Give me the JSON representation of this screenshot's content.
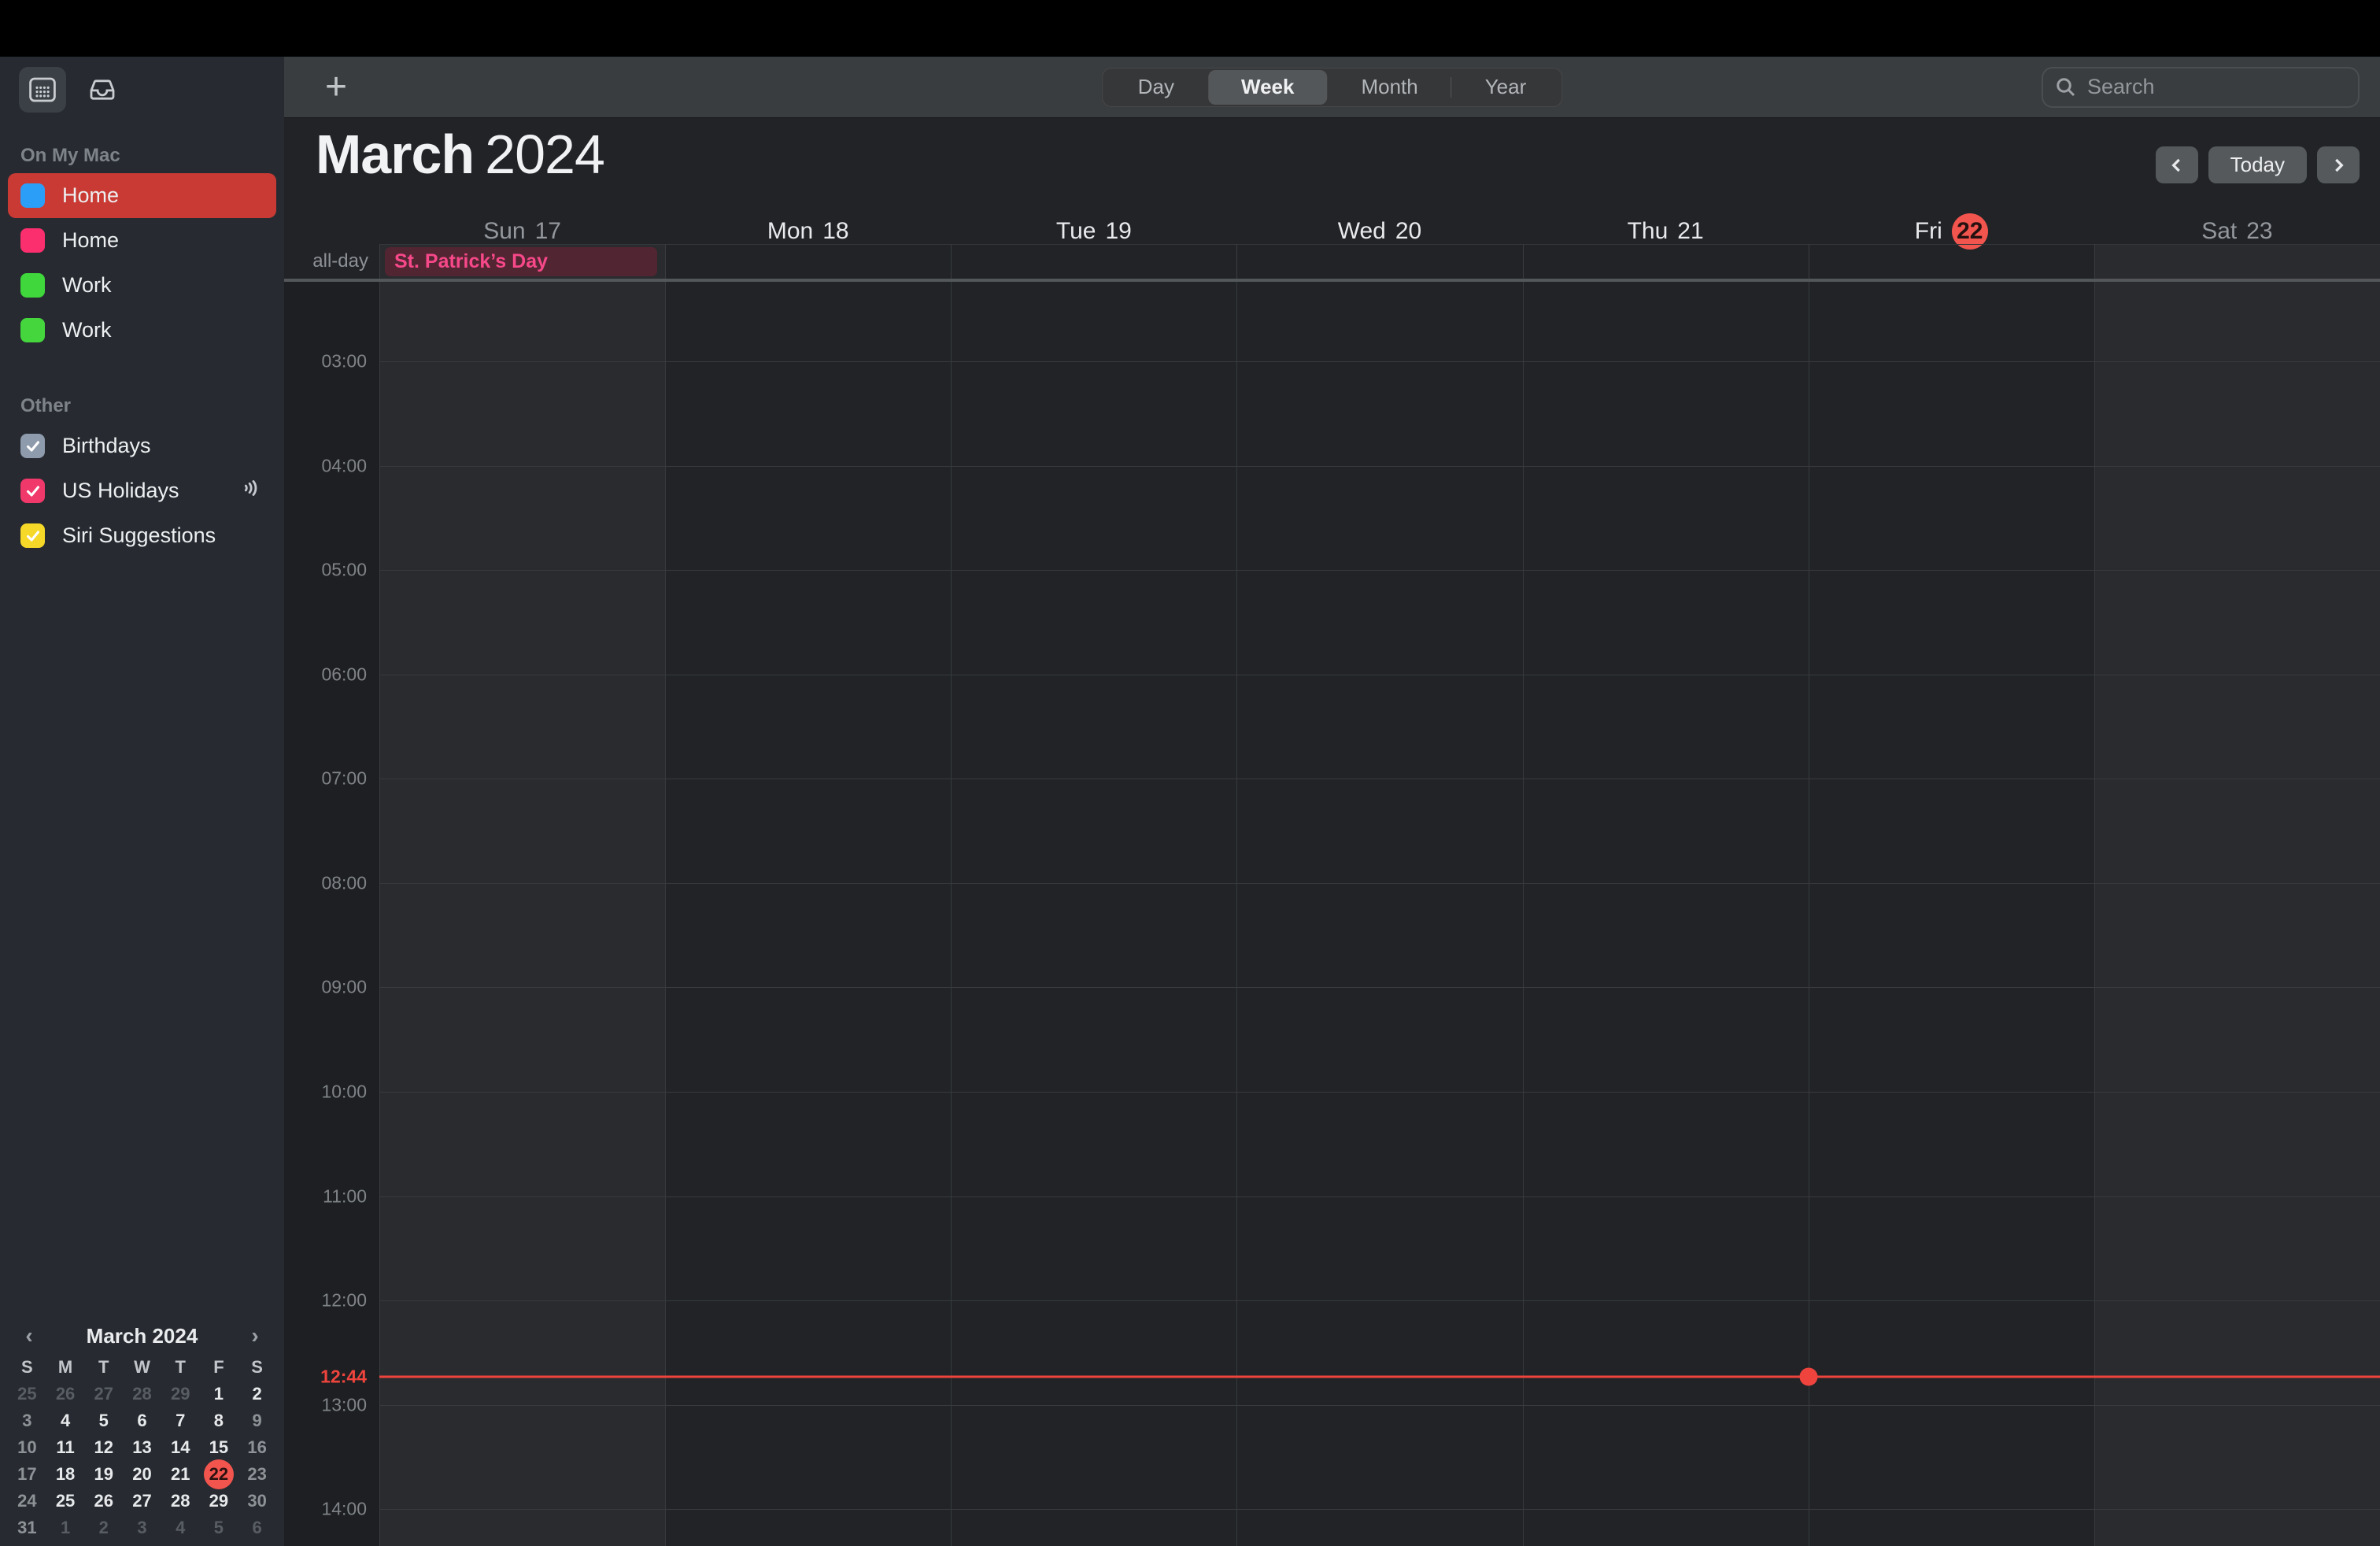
{
  "toolbar": {
    "add_label": "+",
    "tabs": [
      {
        "label": "Day",
        "active": false
      },
      {
        "label": "Week",
        "active": true
      },
      {
        "label": "Month",
        "active": false
      },
      {
        "label": "Year",
        "active": false
      }
    ],
    "search_placeholder": "Search"
  },
  "sidebar": {
    "toolbar_icons": [
      "calendar",
      "inbox"
    ],
    "sections": [
      {
        "title": "On My Mac",
        "items": [
          {
            "label": "Home",
            "color": "#2b9ef7",
            "selected": true
          },
          {
            "label": "Home",
            "color": "#fb2e6e",
            "selected": false
          },
          {
            "label": "Work",
            "color": "#3fd73c",
            "selected": false
          },
          {
            "label": "Work",
            "color": "#45d63e",
            "selected": false
          }
        ]
      },
      {
        "title": "Other",
        "items": [
          {
            "label": "Birthdays",
            "color": "#8e9bac",
            "checked": true
          },
          {
            "label": "US Holidays",
            "color": "#f0386b",
            "checked": true,
            "broadcast": true
          },
          {
            "label": "Siri Suggestions",
            "color": "#f6d928",
            "checked": true
          }
        ]
      }
    ],
    "mini_calendar": {
      "title": "March 2024",
      "dow": [
        "S",
        "M",
        "T",
        "W",
        "T",
        "F",
        "S"
      ],
      "weeks": [
        [
          {
            "d": "25",
            "m": 1
          },
          {
            "d": "26",
            "m": 1
          },
          {
            "d": "27",
            "m": 1
          },
          {
            "d": "28",
            "m": 1
          },
          {
            "d": "29",
            "m": 1
          },
          {
            "d": "1"
          },
          {
            "d": "2"
          }
        ],
        [
          {
            "d": "3",
            "w": 1
          },
          {
            "d": "4"
          },
          {
            "d": "5"
          },
          {
            "d": "6"
          },
          {
            "d": "7"
          },
          {
            "d": "8"
          },
          {
            "d": "9",
            "w": 1
          }
        ],
        [
          {
            "d": "10",
            "w": 1
          },
          {
            "d": "11"
          },
          {
            "d": "12"
          },
          {
            "d": "13"
          },
          {
            "d": "14"
          },
          {
            "d": "15"
          },
          {
            "d": "16",
            "w": 1
          }
        ],
        [
          {
            "d": "17",
            "w": 1
          },
          {
            "d": "18"
          },
          {
            "d": "19"
          },
          {
            "d": "20"
          },
          {
            "d": "21"
          },
          {
            "d": "22",
            "t": 1
          },
          {
            "d": "23",
            "w": 1
          }
        ],
        [
          {
            "d": "24",
            "w": 1
          },
          {
            "d": "25"
          },
          {
            "d": "26"
          },
          {
            "d": "27"
          },
          {
            "d": "28"
          },
          {
            "d": "29"
          },
          {
            "d": "30",
            "w": 1
          }
        ],
        [
          {
            "d": "31",
            "w": 1
          },
          {
            "d": "1",
            "m": 1
          },
          {
            "d": "2",
            "m": 1
          },
          {
            "d": "3",
            "m": 1
          },
          {
            "d": "4",
            "m": 1
          },
          {
            "d": "5",
            "m": 1
          },
          {
            "d": "6",
            "m": 1
          }
        ]
      ]
    }
  },
  "header": {
    "month": "March",
    "year": "2024",
    "today_label": "Today"
  },
  "week": {
    "days": [
      {
        "name": "Sun",
        "num": "17",
        "weekend": true
      },
      {
        "name": "Mon",
        "num": "18"
      },
      {
        "name": "Tue",
        "num": "19"
      },
      {
        "name": "Wed",
        "num": "20"
      },
      {
        "name": "Thu",
        "num": "21"
      },
      {
        "name": "Fri",
        "num": "22",
        "today": true
      },
      {
        "name": "Sat",
        "num": "23",
        "weekend": true
      }
    ],
    "allday_label": "all-day",
    "allday_events": [
      {
        "title": "St. Patrick’s Day",
        "day_index": 0,
        "bg": "#512531",
        "fg": "#f7488a"
      }
    ],
    "hours": [
      "03:00",
      "04:00",
      "05:00",
      "06:00",
      "07:00",
      "08:00",
      "09:00",
      "10:00",
      "11:00",
      "12:00",
      "13:00",
      "14:00"
    ],
    "now": {
      "label": "12:44",
      "hour": 12.7333,
      "day_index": 5
    }
  },
  "colors": {
    "accent_red": "#f2544e",
    "now_line": "#ee443d",
    "selected_row": "#ca3a34",
    "weekend_column": "#292b2e"
  }
}
